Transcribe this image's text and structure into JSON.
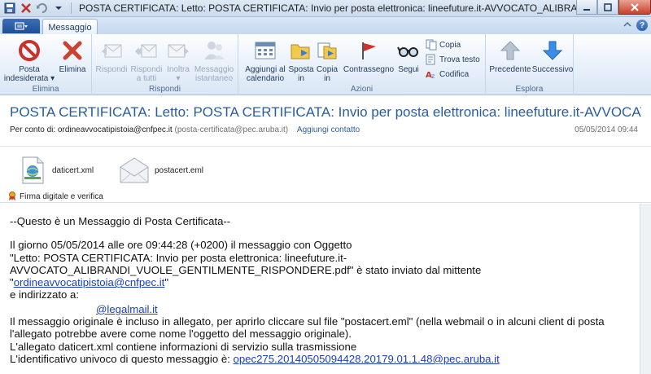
{
  "window": {
    "title": "POSTA CERTIFICATA: Letto: POSTA CERTIFICATA: Invio per posta elettronica: lineefuture.it-AVVOCATO_ALIBRANDI_VUOLE_GENTILM..."
  },
  "tabs": {
    "active": "Messaggio"
  },
  "ribbon": {
    "groups": {
      "elimina": "Elimina",
      "rispondi": "Rispondi",
      "azioni": "Azioni",
      "esplora": "Esplora"
    },
    "buttons": {
      "posta_indesiderata": "Posta\nindesiderata ▾",
      "elimina": "Elimina",
      "rispondi": "Rispondi",
      "rispondi_tutti": "Rispondi\na tutti",
      "inoltra": "Inoltra\n▾",
      "messaggio_istantaneo": "Messaggio\nistantaneo",
      "aggiungi_calendario": "Aggiungi al\ncalendario",
      "sposta_in": "Sposta\nin",
      "copia_in": "Copia\nin",
      "contrassegno": "Contrassegno",
      "segui": "Segui",
      "copia": "Copia",
      "trova_testo": "Trova testo",
      "codifica": "Codifica",
      "precedente": "Precedente",
      "successivo": "Successivo"
    }
  },
  "message": {
    "subject": "POSTA CERTIFICATA: Letto: POSTA CERTIFICATA: Invio per posta elettronica: lineefuture.it-AVVOCATO_ALIBRANDI_VUOLE_GENTILMENTE_RISPONDERE.pdf",
    "from_prefix": "Per conto di: ordineavvocatipistoia@cnfpec.it",
    "from_sender": "(posta-certificata@pec.aruba.it)",
    "add_contact": "Aggiungi contatto",
    "date": "05/05/2014 09:44"
  },
  "attachments": [
    {
      "name": "daticert.xml"
    },
    {
      "name": "postacert.eml"
    }
  ],
  "signature": "Firma digitale e verifica",
  "body": {
    "line1": "--Questo è un Messaggio di Posta Certificata--",
    "line2": "Il giorno 05/05/2014 alle ore 09:44:28 (+0200) il messaggio con Oggetto",
    "line3": "\"Letto: POSTA CERTIFICATA: Invio per posta elettronica: lineefuture.it-",
    "line4": "AVVOCATO_ALIBRANDI_VUOLE_GENTILMENTE_RISPONDERE.pdf\" è stato inviato dal mittente",
    "line5_pre": "\"",
    "line5_link": "ordineavvocatipistoia@cnfpec.it",
    "line5_post": "\"",
    "line6": "e indirizzato a:",
    "line7_link": "@legalmail.it",
    "line8": "Il messaggio originale è incluso in allegato, per aprirlo cliccare sul file \"postacert.eml\" (nella webmail o in alcuni client di posta",
    "line9": "l'allegato potrebbe avere come nome l'oggetto del messaggio originale).",
    "line10": "L'allegato daticert.xml contiene informazioni di servizio sulla trasmissione",
    "line11_pre": "L'identificativo univoco di questo messaggio è: ",
    "line11_link": "opec275.20140505094428.20179.01.1.48@pec.aruba.it"
  }
}
